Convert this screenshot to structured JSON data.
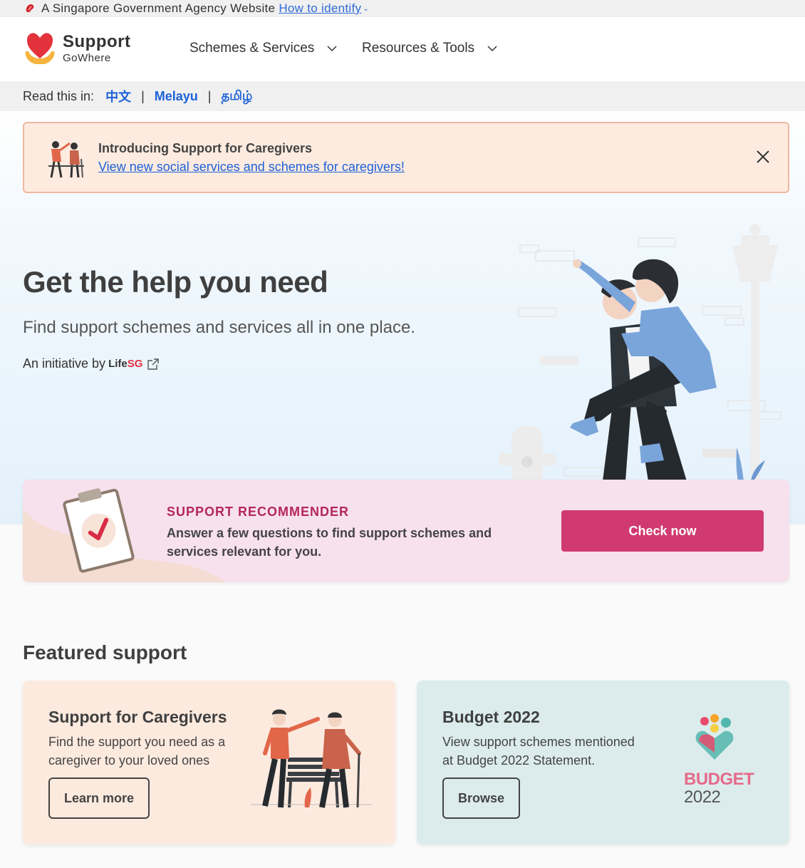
{
  "masthead": {
    "text": "A Singapore Government Agency Website",
    "link": "How to identify"
  },
  "header": {
    "brand_line1": "Support",
    "brand_line2": "GoWhere",
    "nav": [
      {
        "label": "Schemes & Services"
      },
      {
        "label": "Resources & Tools"
      }
    ]
  },
  "language_bar": {
    "label": "Read this in:",
    "languages": [
      "中文",
      "Melayu",
      "தமிழ்"
    ]
  },
  "notice": {
    "title": "Introducing Support for Caregivers",
    "link": "View new social services and schemes for caregivers!"
  },
  "hero": {
    "title": "Get the help you need",
    "subtitle": "Find support schemes and services all in one place.",
    "initiative_prefix": "An initiative by",
    "initiative_brand_a": "Life",
    "initiative_brand_b": "SG"
  },
  "recommender": {
    "title": "SUPPORT RECOMMENDER",
    "description": "Answer a few questions to find support schemes and services relevant for you.",
    "button": "Check now"
  },
  "featured": {
    "title": "Featured support",
    "cards": [
      {
        "title": "Support for Caregivers",
        "description": "Find the support you need as a caregiver to your loved ones",
        "button": "Learn more"
      },
      {
        "title": "Budget 2022",
        "description": "View support schemes mentioned at Budget 2022 Statement.",
        "button": "Browse",
        "logo_text_1": "BUDGET",
        "logo_text_2": "2022"
      }
    ]
  },
  "colors": {
    "link": "#1d61d8",
    "primary_button": "#d03a6f",
    "recommender_bg": "#f7e1ec",
    "recommender_title": "#b4265e",
    "caregiver_card_bg": "#fdeadf",
    "budget_card_bg": "#dcecec"
  }
}
